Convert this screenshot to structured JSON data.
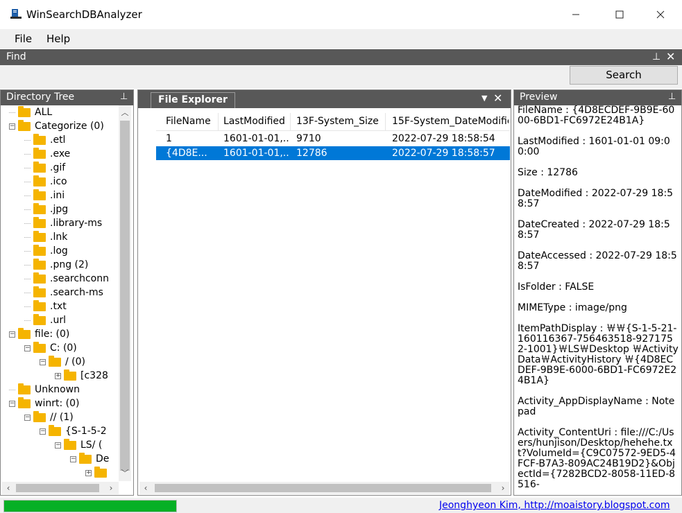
{
  "window": {
    "title": "WinSearchDBAnalyzer"
  },
  "menu": {
    "file": "File",
    "help": "Help"
  },
  "find": {
    "title": "Find",
    "search_button": "Search"
  },
  "directory_tree": {
    "title": "Directory Tree",
    "nodes": [
      {
        "label": "ALL",
        "depth": 0,
        "expander": ""
      },
      {
        "label": "Categorize (0)",
        "depth": 0,
        "expander": "−"
      },
      {
        "label": ".etl",
        "depth": 1,
        "expander": ""
      },
      {
        "label": ".exe",
        "depth": 1,
        "expander": ""
      },
      {
        "label": ".gif",
        "depth": 1,
        "expander": ""
      },
      {
        "label": ".ico",
        "depth": 1,
        "expander": ""
      },
      {
        "label": ".ini",
        "depth": 1,
        "expander": ""
      },
      {
        "label": ".jpg",
        "depth": 1,
        "expander": ""
      },
      {
        "label": ".library-ms",
        "depth": 1,
        "expander": ""
      },
      {
        "label": ".lnk",
        "depth": 1,
        "expander": ""
      },
      {
        "label": ".log",
        "depth": 1,
        "expander": ""
      },
      {
        "label": ".png (2)",
        "depth": 1,
        "expander": ""
      },
      {
        "label": ".searchconn",
        "depth": 1,
        "expander": ""
      },
      {
        "label": ".search-ms",
        "depth": 1,
        "expander": ""
      },
      {
        "label": ".txt",
        "depth": 1,
        "expander": ""
      },
      {
        "label": ".url",
        "depth": 1,
        "expander": ""
      },
      {
        "label": "file: (0)",
        "depth": 0,
        "expander": "−"
      },
      {
        "label": "C: (0)",
        "depth": 1,
        "expander": "−"
      },
      {
        "label": "/ (0)",
        "depth": 2,
        "expander": "−"
      },
      {
        "label": "[c328",
        "depth": 3,
        "expander": "+"
      },
      {
        "label": "Unknown",
        "depth": 0,
        "expander": ""
      },
      {
        "label": "winrt: (0)",
        "depth": 0,
        "expander": "−"
      },
      {
        "label": "// (1)",
        "depth": 1,
        "expander": "−"
      },
      {
        "label": "{S-1-5-2",
        "depth": 2,
        "expander": "−"
      },
      {
        "label": "LS/ (",
        "depth": 3,
        "expander": "−"
      },
      {
        "label": "De",
        "depth": 4,
        "expander": "−"
      },
      {
        "label": "",
        "depth": 5,
        "expander": "+"
      }
    ]
  },
  "file_explorer": {
    "tab": "File Explorer",
    "columns": [
      "FileName",
      "LastModified",
      "13F-System_Size",
      "15F-System_DateModified"
    ],
    "rows": [
      [
        "1",
        "1601-01-01,..",
        "9710",
        "2022-07-29 18:58:54"
      ],
      [
        "{4D8E...",
        "1601-01-01,..",
        "12786",
        "2022-07-29 18:58:57"
      ]
    ],
    "selected_row": 1
  },
  "preview": {
    "title": "Preview",
    "entries": [
      "FileName : {4D8ECDEF-9B9E-6000-6BD1-FC6972E24B1A}",
      "LastModified : 1601-01-01 09:00:00",
      "Size : 12786",
      "DateModified : 2022-07-29 18:58:57",
      "DateCreated : 2022-07-29 18:58:57",
      "DateAccessed : 2022-07-29 18:58:57",
      "IsFolder : FALSE",
      "MIMEType : image/png",
      "ItemPathDisplay : ￦￦{S-1-5-21-160116367-756463518-9271752-1001}￦LS￦Desktop ￦ActivityData￦ActivityHistory ￦{4D8ECDEF-9B9E-6000-6BD1-FC6972E24B1A}",
      "Activity_AppDisplayName : Notepad",
      "Activity_ContentUri : file:///C:/Users/hunjison/Desktop/hehehe.txt?VolumeId={C9C07572-9ED5-4FCF-B7A3-809AC24B19D2}&ObjectId={7282BCD2-8058-11ED-8516-"
    ]
  },
  "status": {
    "progress_fraction": 1.0,
    "link": "Jeonghyeon Kim, http://moaistory.blogspot.com"
  },
  "colors": {
    "panel_header": "#585858",
    "selection": "#0078d7",
    "progress": "#06b025",
    "folder": "#f5b400"
  }
}
